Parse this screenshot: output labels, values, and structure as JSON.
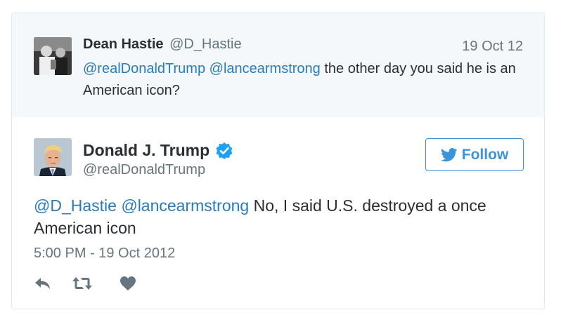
{
  "quoted_tweet": {
    "author_name": "Dean Hastie",
    "author_handle": "@D_Hastie",
    "date": "19 Oct 12",
    "mention_1": "@realDonaldTrump",
    "mention_2": "@lancearmstrong",
    "text": " the other day you said he is an American icon?"
  },
  "main_tweet": {
    "author_name": "Donald J. Trump",
    "author_handle": "@realDonaldTrump",
    "follow_label": "Follow",
    "mention_1": "@D_Hastie",
    "mention_2": "@lancearmstrong",
    "text": " No, I said U.S. destroyed a once American icon",
    "timestamp": "5:00 PM - 19 Oct 2012"
  },
  "icons": {
    "verified": "verified-badge-icon",
    "follow_bird": "twitter-bird-icon",
    "reply": "reply-icon",
    "retweet": "retweet-icon",
    "like": "heart-icon"
  },
  "colors": {
    "link": "#2b7bb9",
    "follow": "#3b94d9",
    "muted": "#66757f",
    "verified": "#1da1f2",
    "action_icon": "#66757f"
  }
}
